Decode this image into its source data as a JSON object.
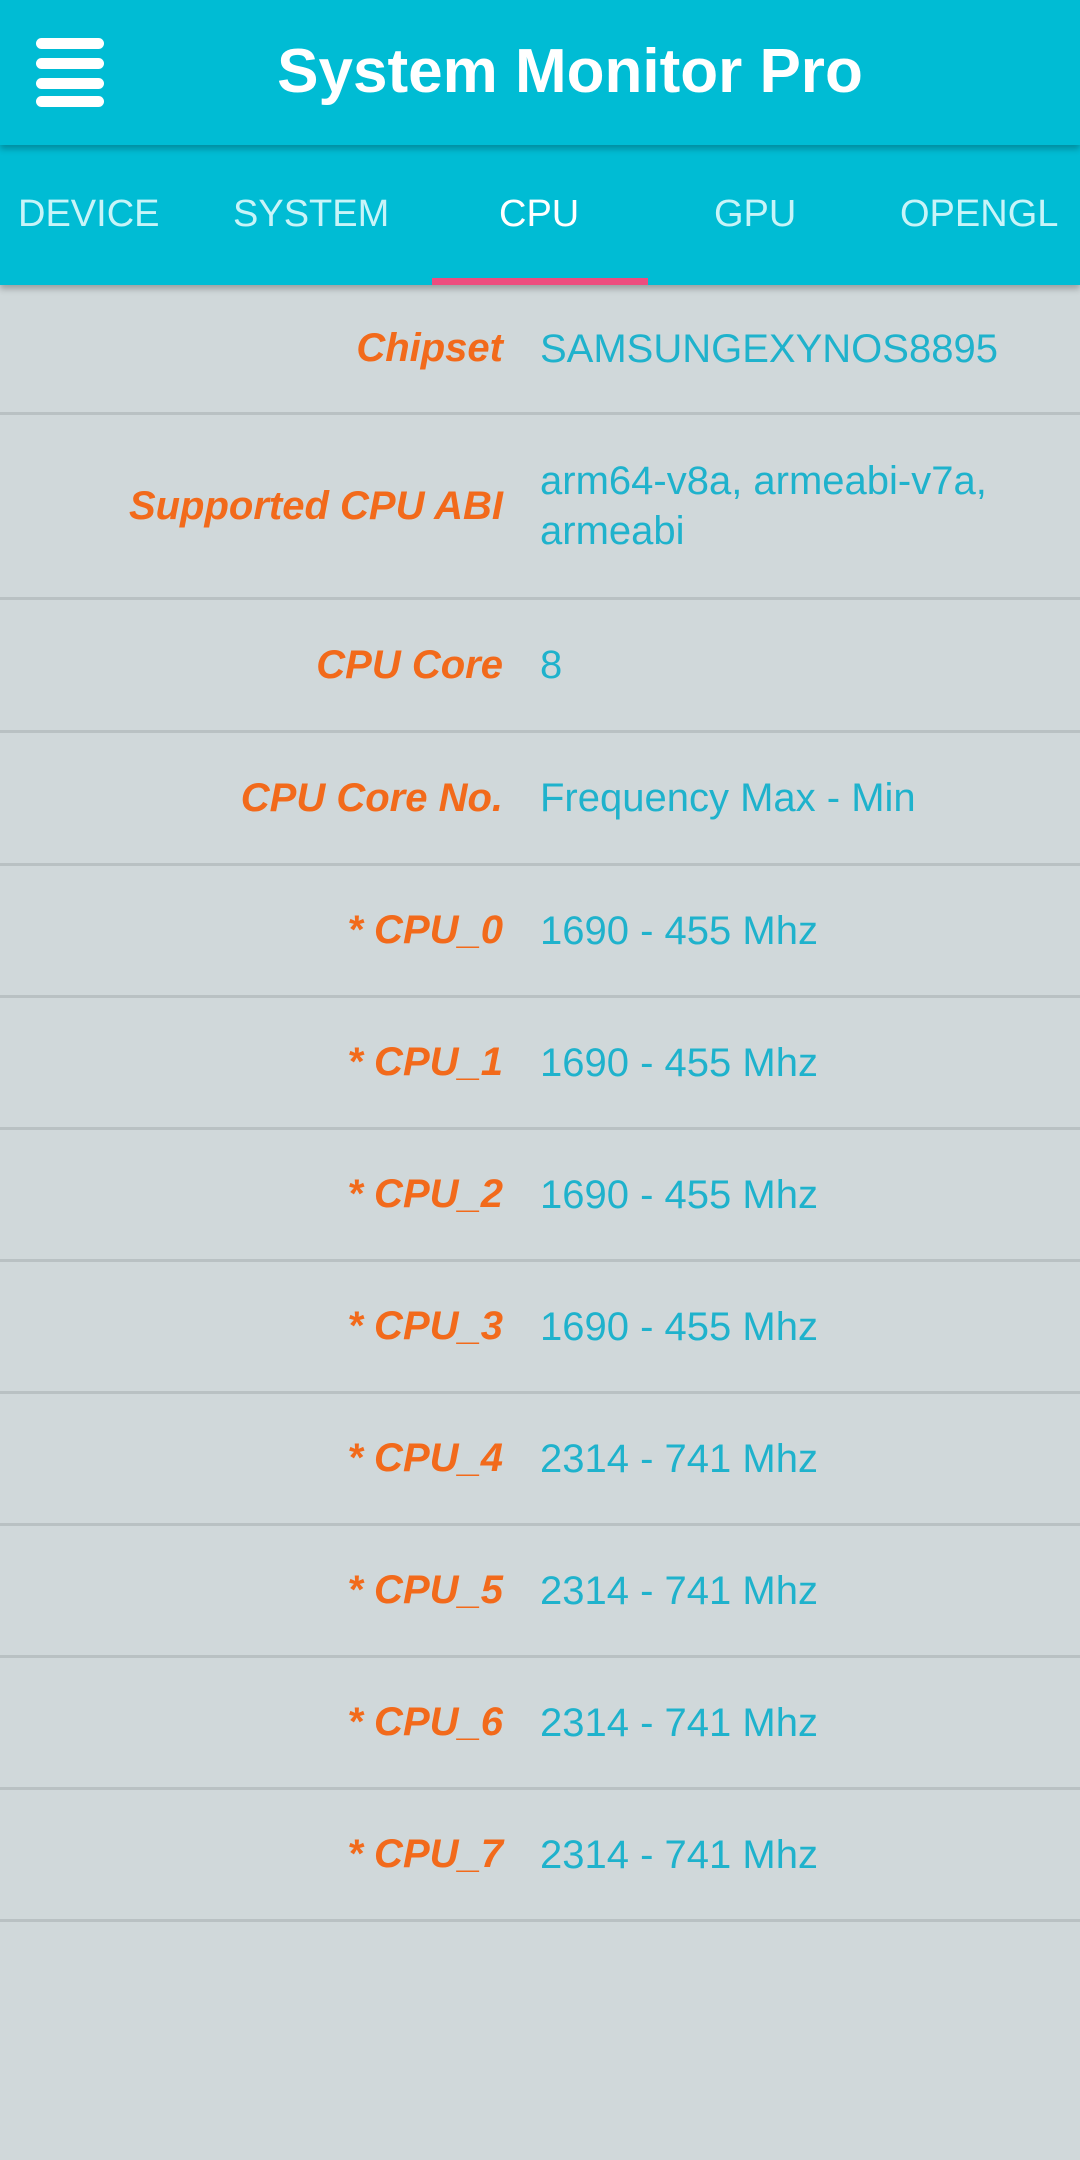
{
  "header": {
    "title": "System Monitor Pro",
    "menu_icon": "hamburger-menu-icon"
  },
  "tabs": [
    {
      "label": "DEVICE",
      "active": false
    },
    {
      "label": "SYSTEM",
      "active": false
    },
    {
      "label": "CPU",
      "active": true
    },
    {
      "label": "GPU",
      "active": false
    },
    {
      "label": "OPENGL",
      "active": false
    }
  ],
  "colors": {
    "accent": "#00bcd4",
    "indicator": "#ec4d7f",
    "label": "#f26a1b",
    "value": "#1fb2cc",
    "background": "#d0d8da"
  },
  "rows": [
    {
      "label": "Chipset",
      "value": "SAMSUNGEXYNOS8895"
    },
    {
      "label": "Supported CPU ABI",
      "value": "arm64-v8a, armeabi-v7a, armeabi"
    },
    {
      "label": "CPU Core",
      "value": "8"
    },
    {
      "label": "CPU Core No.",
      "value": "Frequency Max - Min"
    },
    {
      "label": "* CPU_0",
      "value": "1690 - 455 Mhz"
    },
    {
      "label": "* CPU_1",
      "value": "1690 - 455 Mhz"
    },
    {
      "label": "* CPU_2",
      "value": "1690 - 455 Mhz"
    },
    {
      "label": "* CPU_3",
      "value": "1690 - 455 Mhz"
    },
    {
      "label": "* CPU_4",
      "value": "2314 - 741 Mhz"
    },
    {
      "label": "* CPU_5",
      "value": "2314 - 741 Mhz"
    },
    {
      "label": "* CPU_6",
      "value": "2314 - 741 Mhz"
    },
    {
      "label": "* CPU_7",
      "value": "2314 - 741 Mhz"
    }
  ]
}
